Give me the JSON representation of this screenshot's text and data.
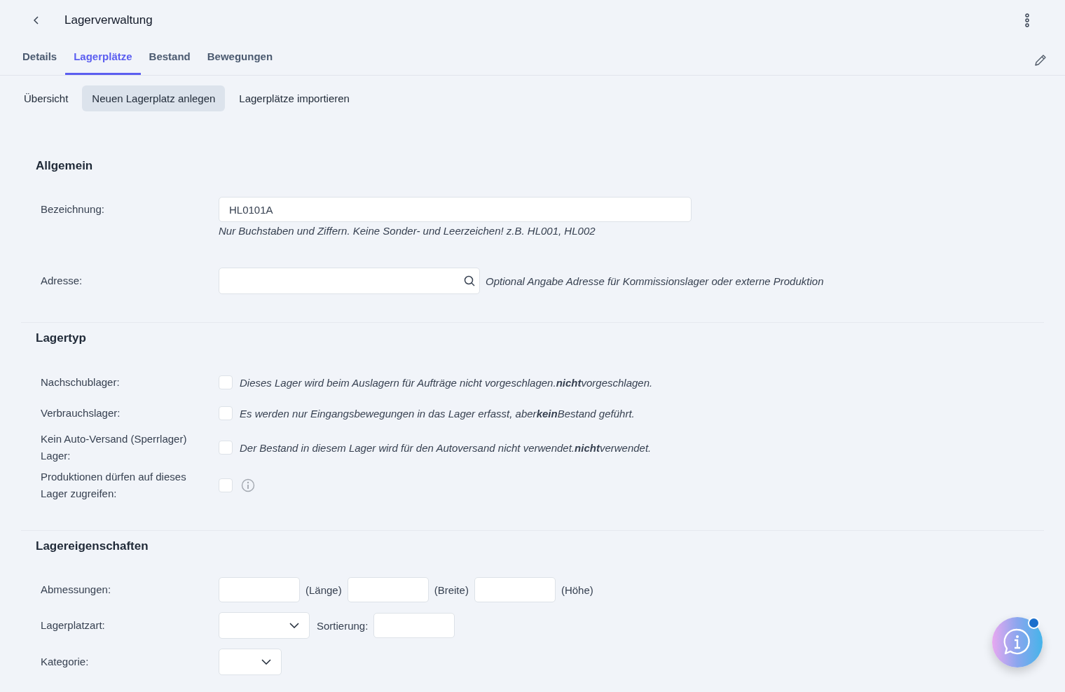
{
  "header": {
    "title": "Lagerverwaltung"
  },
  "tabs": [
    {
      "label": "Details",
      "selected": false
    },
    {
      "label": "Lagerplätze",
      "selected": true
    },
    {
      "label": "Bestand",
      "selected": false
    },
    {
      "label": "Bewegungen",
      "selected": false
    }
  ],
  "subnav": [
    {
      "label": "Übersicht",
      "selected": false
    },
    {
      "label": "Neuen Lagerplatz anlegen",
      "selected": true
    },
    {
      "label": "Lagerplätze importieren",
      "selected": false
    }
  ],
  "allgemein": {
    "heading": "Allgemein",
    "bezeichnung": {
      "label": "Bezeichnung:",
      "value": "HL0101A",
      "hint": "Nur Buchstaben und Ziffern. Keine Sonder- und Leerzeichen! z.B. HL001, HL002"
    },
    "adresse": {
      "label": "Adresse:",
      "hint": "Optional Angabe Adresse für Kommissionslager oder externe Produktion"
    }
  },
  "lagertyp": {
    "heading": "Lagertyp",
    "rows": [
      {
        "kind": "text",
        "label": "Nachschublager:",
        "checked": false,
        "description": "Dieses Lager wird beim Auslagern für Aufträge nicht vorgeschlagen.**nicht**vorgeschlagen."
      },
      {
        "kind": "text",
        "label": "Verbrauchslager:",
        "checked": false,
        "description": "Es werden nur Eingangsbewegungen in das Lager erfasst, aber**kein**Bestand geführt."
      },
      {
        "kind": "text",
        "label": "Kein Auto-Versand (Sperrlager) Lager:",
        "checked": false,
        "description": "Der Bestand in diesem Lager wird für den Autoversand nicht verwendet.**nicht**verwendet."
      },
      {
        "kind": "info",
        "label": "Produktionen dürfen auf dieses Lager zugreifen:",
        "checked": false
      }
    ]
  },
  "lagereigenschaften": {
    "heading": "Lagereigenschaften",
    "abmessungen": {
      "label": "Abmessungen:",
      "units": [
        "(Länge)",
        "(Breite)",
        "(Höhe)"
      ]
    },
    "lagerplatzart": {
      "label": "Lagerplatzart:",
      "sort_label": "Sortierung:"
    },
    "kategorie": {
      "label": "Kategorie:"
    }
  }
}
